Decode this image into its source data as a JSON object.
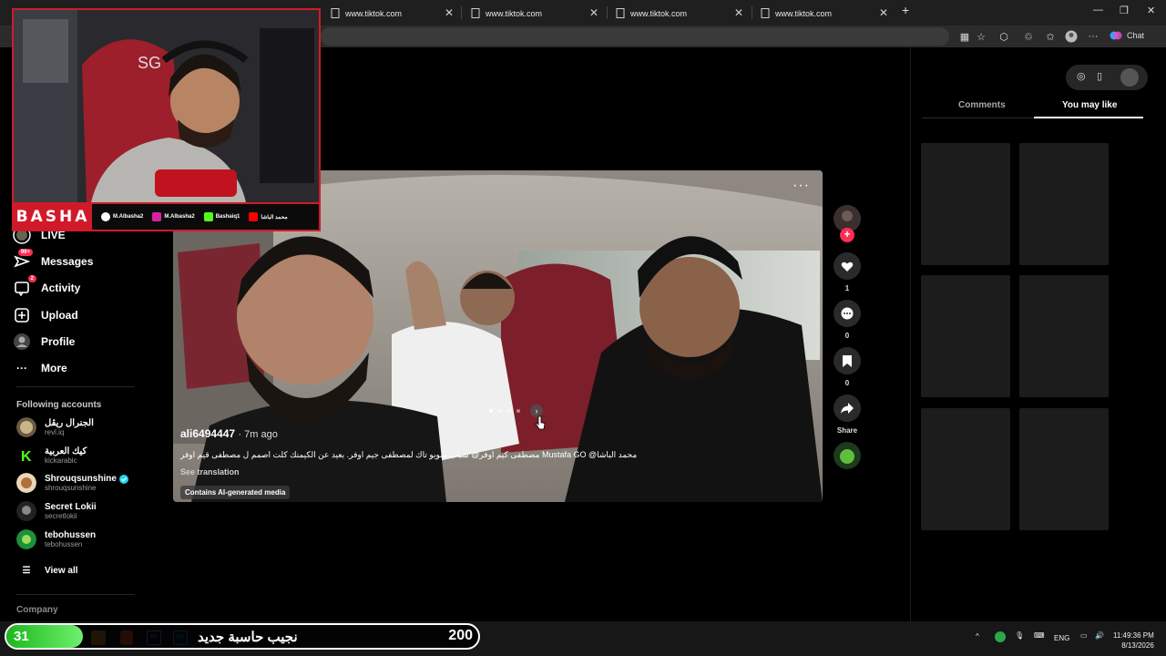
{
  "browser": {
    "tabs": [
      {
        "title": "www.tiktok.com"
      },
      {
        "title": "www.tiktok.com"
      },
      {
        "title": "www.tiktok.com"
      },
      {
        "title": "www.tiktok.com"
      },
      {
        "title": "www.tiktok.com"
      }
    ],
    "chat_label": "Chat"
  },
  "sidebar": {
    "items": [
      {
        "label": "LIVE",
        "icon": "live-icon"
      },
      {
        "label": "Messages",
        "icon": "messages-icon",
        "badge": "99+"
      },
      {
        "label": "Activity",
        "icon": "activity-icon",
        "badge": "2"
      },
      {
        "label": "Upload",
        "icon": "upload-icon"
      },
      {
        "label": "Profile",
        "icon": "profile-icon"
      },
      {
        "label": "More",
        "icon": "more-icon"
      }
    ],
    "following_title": "Following accounts",
    "accounts": [
      {
        "name": "الجنرال ريڤل",
        "handle": "revl.iq"
      },
      {
        "name": "كيك العربية",
        "handle": "kickarabic"
      },
      {
        "name": "Shrouqsunshine",
        "handle": "shrouqsunshine",
        "verified": true
      },
      {
        "name": "Secret Lokii",
        "handle": "secretlokii"
      },
      {
        "name": "tebohussen",
        "handle": "tebohussen"
      }
    ],
    "view_all": "View all",
    "company": "Company"
  },
  "video": {
    "username": "ali6494447",
    "time_ago": "· 7m ago",
    "caption": "محمد الباشا@ Mustafa GO مصطفى كيم اوفر@  شباب سويو تاك لمصطفى جيم اوفر. بعيد عن الكيمنك كلت اصمم ل مصطفى قيم اوفر",
    "see_translation": "See translation",
    "ai_label": "Contains AI-generated media",
    "more": "···"
  },
  "actions": {
    "likes": "1",
    "comments": "0",
    "saves": "0",
    "share_label": "Share"
  },
  "right_panel": {
    "tab_comments": "Comments",
    "tab_you_may_like": "You may like"
  },
  "stream_overlay": {
    "brand": "BASHA",
    "socials": [
      "M.Albasha2",
      "M.Albasha2",
      "Bashaiq1",
      "محمد الباشا"
    ]
  },
  "sub_goal": {
    "count": "31",
    "text": "نجيب حاسبة جديد",
    "goal": "200"
  },
  "taskbar": {
    "lang": "ENG",
    "time": "11:49:36 PM",
    "date": "8/13/2026"
  },
  "colors": {
    "accent": "#fe2c55",
    "overlay_red": "#d01a2a",
    "goal_green": "#1db81d"
  }
}
